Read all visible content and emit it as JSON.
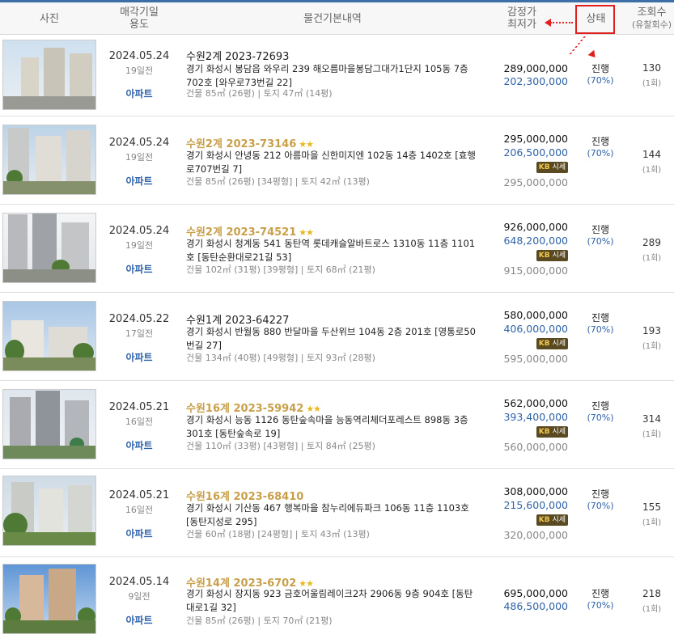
{
  "header": {
    "photo": "사진",
    "date": "매각기일",
    "use": "용도",
    "info": "물건기본내역",
    "appraisal": "감정가",
    "minimum": "최저가",
    "status": "상태",
    "views": "조회수",
    "views_sub": "(유찰회수)"
  },
  "market_badge": {
    "mark": "KB",
    "label": "시세"
  },
  "colors": {
    "accent": "#2e62a8",
    "gold": "#c9a04a",
    "highlight": "#e01f1f"
  },
  "rows": [
    {
      "date": "2024.05.24",
      "days": "19일전",
      "use": "아파트",
      "title": "수원2계 2023-72693",
      "starred": false,
      "stars": "",
      "address": "경기 화성시 봉담읍 와우리 239 해오름마을봉담그대가1단지 105동 7층 702호 [와우로73번길 22]",
      "area": "건물 85㎡ (26평)  |  토지 47㎡ (14평)",
      "appraisal": "289,000,000",
      "minimum": "202,300,000",
      "market": "",
      "status": "진행",
      "percent": "(70%)",
      "views": "130",
      "fails": "(1회)"
    },
    {
      "date": "2024.05.24",
      "days": "19일전",
      "use": "아파트",
      "title": "수원2계 2023-73146",
      "starred": true,
      "stars": "★★",
      "address": "경기 화성시 안녕동 212 아름마을 신한미지엔 102동 14층 1402호 [효행로707번길 7]",
      "area": "건물 85㎡ (26평) [34평형]  |  토지 42㎡ (13평)",
      "appraisal": "295,000,000",
      "minimum": "206,500,000",
      "market": "295,000,000",
      "status": "진행",
      "percent": "(70%)",
      "views": "144",
      "fails": "(1회)"
    },
    {
      "date": "2024.05.24",
      "days": "19일전",
      "use": "아파트",
      "title": "수원2계 2023-74521",
      "starred": true,
      "stars": "★★",
      "address": "경기 화성시 청계동 541 동탄역 롯데캐슬알바트로스 1310동 11층 1101호 [동탄순환대로21길 53]",
      "area": "건물 102㎡ (31평) [39평형]  |  토지 68㎡ (21평)",
      "appraisal": "926,000,000",
      "minimum": "648,200,000",
      "market": "915,000,000",
      "status": "진행",
      "percent": "(70%)",
      "views": "289",
      "fails": "(1회)"
    },
    {
      "date": "2024.05.22",
      "days": "17일전",
      "use": "아파트",
      "title": "수원1계 2023-64227",
      "starred": false,
      "stars": "",
      "address": "경기 화성시 반월동 880 반달마을 두산위브 104동 2층 201호 [영통로50번길 27]",
      "area": "건물 134㎡ (40평) [49평형]  |  토지 93㎡ (28평)",
      "appraisal": "580,000,000",
      "minimum": "406,000,000",
      "market": "595,000,000",
      "status": "진행",
      "percent": "(70%)",
      "views": "193",
      "fails": "(1회)"
    },
    {
      "date": "2024.05.21",
      "days": "16일전",
      "use": "아파트",
      "title": "수원16계 2023-59942",
      "starred": true,
      "stars": "★★",
      "address": "경기 화성시 능동 1126 동탄숲속마을 능동역리체더포레스트 898동 3층 301호 [동탄숲속로 19]",
      "area": "건물 110㎡ (33평) [43평형]  |  토지 84㎡ (25평)",
      "appraisal": "562,000,000",
      "minimum": "393,400,000",
      "market": "560,000,000",
      "status": "진행",
      "percent": "(70%)",
      "views": "314",
      "fails": "(1회)"
    },
    {
      "date": "2024.05.21",
      "days": "16일전",
      "use": "아파트",
      "title": "수원16계 2023-68410",
      "starred": false,
      "stars": "",
      "address": "경기 화성시 기산동 467 행복마을 참누리에듀파크 106동 11층 1103호 [동탄지성로 295]",
      "area": "건물 60㎡ (18평) [24평형]  |  토지 43㎡ (13평)",
      "appraisal": "308,000,000",
      "minimum": "215,600,000",
      "market": "320,000,000",
      "status": "진행",
      "percent": "(70%)",
      "views": "155",
      "fails": "(1회)"
    },
    {
      "date": "2024.05.14",
      "days": "9일전",
      "use": "아파트",
      "title": "수원14계 2023-6702",
      "starred": true,
      "stars": "★★",
      "address": "경기 화성시 장지동 923 금호어울림레이크2차 2906동 9층 904호 [동탄대로1길 32]",
      "area": "건물 85㎡ (26평)  |  토지 70㎡ (21평)",
      "appraisal": "695,000,000",
      "minimum": "486,500,000",
      "market": "",
      "status": "진행",
      "percent": "(70%)",
      "views": "218",
      "fails": "(1회)"
    }
  ]
}
